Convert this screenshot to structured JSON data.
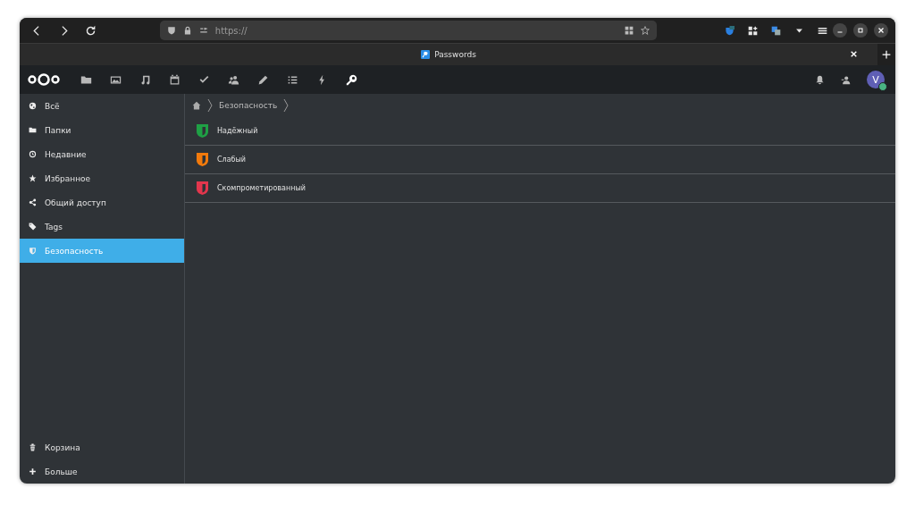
{
  "browser": {
    "url": "https://",
    "tab": {
      "title": "Passwords"
    }
  },
  "apps": [
    {
      "kind": "files",
      "selected": false
    },
    {
      "kind": "photos",
      "selected": false
    },
    {
      "kind": "music",
      "selected": false
    },
    {
      "kind": "calendar",
      "selected": false
    },
    {
      "kind": "tasks",
      "selected": false
    },
    {
      "kind": "contacts",
      "selected": false
    },
    {
      "kind": "notes",
      "selected": false
    },
    {
      "kind": "deck",
      "selected": false
    },
    {
      "kind": "activity",
      "selected": false
    },
    {
      "kind": "passwords",
      "selected": true
    }
  ],
  "user": {
    "initial": "V"
  },
  "sidebar": {
    "items": [
      {
        "kind": "all",
        "label": "Всё",
        "selected": false
      },
      {
        "kind": "folders",
        "label": "Папки",
        "selected": false
      },
      {
        "kind": "recent",
        "label": "Недавние",
        "selected": false
      },
      {
        "kind": "favorites",
        "label": "Избранное",
        "selected": false
      },
      {
        "kind": "shared",
        "label": "Общий доступ",
        "selected": false
      },
      {
        "kind": "tags",
        "label": "Tags",
        "selected": false
      },
      {
        "kind": "security",
        "label": "Безопасность",
        "selected": true
      }
    ],
    "footer": [
      {
        "kind": "trash",
        "label": "Корзина"
      },
      {
        "kind": "more",
        "label": "Больше"
      }
    ]
  },
  "breadcrumb": [
    "Безопасность"
  ],
  "security_levels": [
    {
      "label": "Надёжный",
      "color": "#1fa045"
    },
    {
      "label": "Слабый",
      "color": "#f27a0c"
    },
    {
      "label": "Скомпрометированный",
      "color": "#e2364d"
    }
  ]
}
